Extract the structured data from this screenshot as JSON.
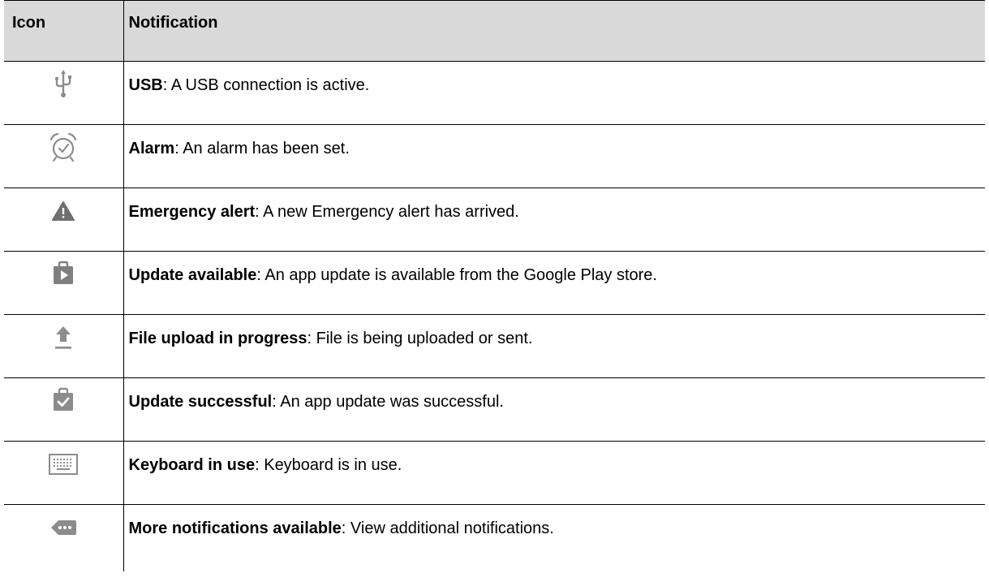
{
  "header": {
    "icon_col": "Icon",
    "notification_col": "Notification"
  },
  "rows": [
    {
      "icon": "usb-icon",
      "term": "USB",
      "desc": ": A USB connection is active."
    },
    {
      "icon": "alarm-icon",
      "term": "Alarm",
      "desc": ": An alarm has been set."
    },
    {
      "icon": "warning-icon",
      "term": "Emergency alert",
      "desc": ": A new Emergency alert has arrived."
    },
    {
      "icon": "play-store-update-icon",
      "term": "Update available",
      "desc": ": An app update is available from the Google Play store."
    },
    {
      "icon": "upload-icon",
      "term": "File upload in progress",
      "desc": ": File is being uploaded or sent."
    },
    {
      "icon": "update-success-icon",
      "term": "Update successful",
      "desc": ": An app update was successful."
    },
    {
      "icon": "keyboard-icon",
      "term": "Keyboard in use",
      "desc": ": Keyboard is in use."
    },
    {
      "icon": "more-notifications-icon",
      "term": "More notifications available",
      "desc": ": View additional notifications."
    }
  ],
  "colors": {
    "header_bg": "#d9d9d9",
    "icon_gray": "#8c8c8c"
  }
}
